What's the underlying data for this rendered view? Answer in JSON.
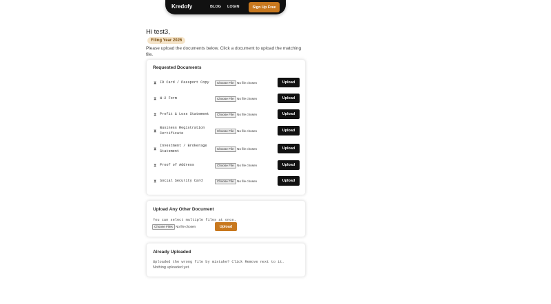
{
  "nav": {
    "brand": "Kredofy",
    "links": [
      "BLOG",
      "LOGIN"
    ],
    "cta": "Sign Up Free"
  },
  "greeting": "Hi test3,",
  "badge": "Filing Year 2026",
  "instructions": "Please upload the documents below. Click a document to upload the matching file.",
  "requested": {
    "title": "Requested Documents",
    "icon": "hourglass-icon",
    "choose_label": "Choose File",
    "no_file_label": "No file chosen",
    "upload_label": "Upload",
    "documents": [
      "ID Card / Passport Copy",
      "W-2 Form",
      "Profit & Loss Statement",
      "Business Registration Certificate",
      "Investment / Brokerage Statement",
      "Proof of Address",
      "Social Security Card"
    ]
  },
  "other": {
    "title": "Upload Any Other Document",
    "note": "You can select multiple files at once.",
    "choose_label": "Choose Files",
    "no_file_label": "No file chosen",
    "upload_label": "Upload"
  },
  "uploaded": {
    "title": "Already Uploaded",
    "note": "Uploaded the wrong file by mistake? Click Remove next to it.",
    "empty": "Nothing uploaded yet."
  },
  "colors": {
    "accent": "#c8781e",
    "nav_bg": "#111111",
    "badge_bg": "#f4e3c8"
  }
}
